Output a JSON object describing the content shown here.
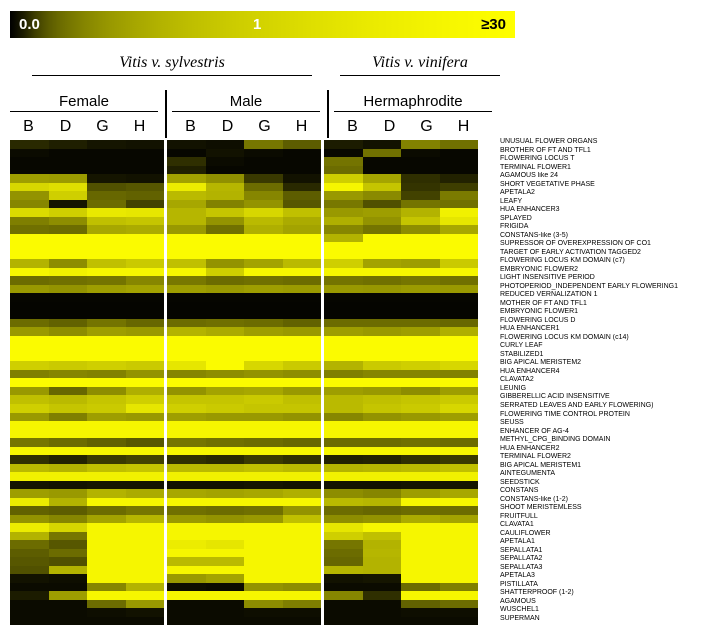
{
  "colorbar": {
    "min_label": "0.0",
    "mid_label": "1",
    "max_label": "≥30",
    "black_hex": "#000000",
    "yellow_hex": "#ffff00"
  },
  "headers": {
    "species": [
      {
        "label": "Vitis v. sylvestris"
      },
      {
        "label": "Vitis v. vinifera"
      }
    ],
    "groups": [
      {
        "label": "Female"
      },
      {
        "label": "Male"
      },
      {
        "label": "Hermaphrodite"
      }
    ],
    "columns": [
      "B",
      "D",
      "G",
      "H",
      "B",
      "D",
      "G",
      "H",
      "B",
      "D",
      "G",
      "H"
    ]
  },
  "chart_data": {
    "type": "heatmap",
    "title": "",
    "xlabel": "",
    "ylabel": "",
    "colormap": "black-to-yellow",
    "value_range": [
      0.0,
      30.0
    ],
    "colorbar_ticks": [
      0.0,
      1.0,
      30.0
    ],
    "column_groups": [
      {
        "species": "Vitis v. sylvestris",
        "sex": "Female",
        "columns": [
          "B",
          "D",
          "G",
          "H"
        ]
      },
      {
        "species": "Vitis v. sylvestris",
        "sex": "Male",
        "columns": [
          "B",
          "D",
          "G",
          "H"
        ]
      },
      {
        "species": "Vitis v. vinifera",
        "sex": "Hermaphrodite",
        "columns": [
          "B",
          "D",
          "G",
          "H"
        ]
      }
    ],
    "x": [
      "B",
      "D",
      "G",
      "H",
      "B",
      "D",
      "G",
      "H",
      "B",
      "D",
      "G",
      "H"
    ],
    "y": [
      "UNUSUAL FLOWER ORGANS",
      "BROTHER OF FT AND TFL1",
      "FLOWERING LOCUS T",
      "TERMINAL FLOWER1",
      "AGAMOUS like  24",
      "SHORT VEGETATIVE PHASE",
      "APETALA2",
      "LEAFY",
      "HUA ENHANCER3",
      "SPLAYED",
      "FRIGIDA",
      "CONSTANS-like  (3-5)",
      "SUPRESSOR OF OVEREXPRESSION OF CO1",
      "TARGET OF EARLY ACTIVATION TAGGED2",
      "FLOWERING LOCUS KM DOMAIN (c7)",
      "EMBRYONIC FLOWER2",
      "LIGHT INSENSITIVE PERIOD",
      "PHOTOPERIOD_INDEPENDENT EARLY FLOWERING1",
      "REDUCED VERNALIZATION 1",
      "MOTHER OF FT AND TFL1",
      "EMBRYONIC FLOWER1",
      "FLOWERING LOCUS D",
      "HUA ENHANCER1",
      "FLOWERING LOCUS KM DOMAIN (c14)",
      "CURLY LEAF",
      "STABILIZED1",
      "BIG APICAL MERISTEM2",
      "HUA ENHANCER4",
      "CLAVATA2",
      "LEUNIG",
      "GIBBERELLIC ACID INSENSITIVE",
      "SERRATED LEAVES AND EARLY FLOWERING)",
      "FLOWERING TIME CONTROL PROTEIN",
      "SEUSS",
      "ENHANCER OF AG-4",
      "METHYL_CPG_BINDING DOMAIN",
      "HUA ENHANCER2",
      "TERMINAL FLOWER2",
      "BIG APICAL MERISTEM1",
      "AINTEGUMENTA",
      "SEEDSTICK",
      "CONSTANS",
      "CONSTANS-like  (1-2)",
      "SHOOT MERISTEMLESS",
      "FRUITFULL",
      "CLAVATA1",
      "CAULIFLOWER",
      "APETALA1",
      "SEPALLATA1",
      "SEPALLATA2",
      "SEPALLATA3",
      "APETALA3",
      "PISTILLATA",
      "SHATTERPROOF (1-2)",
      "AGAMOUS",
      "WUSCHEL1",
      "SUPERMAN"
    ],
    "values": [
      [
        1.1,
        0.9,
        0.6,
        0.5,
        0.5,
        0.4,
        3.5,
        2.4,
        0.8,
        0.5,
        4.2,
        3.2,
        0.4,
        0.3
      ],
      [
        0.3,
        0.2,
        0.2,
        0.2,
        0.2,
        0.5,
        0.3,
        0.2,
        0.2,
        3.2,
        0.3,
        0.2
      ],
      [
        0.2,
        0.2,
        0.2,
        0.2,
        1.2,
        0.3,
        0.2,
        0.2,
        3.4,
        0.2,
        0.2,
        0.2
      ],
      [
        0.2,
        0.2,
        0.2,
        0.2,
        0.9,
        0.2,
        0.2,
        0.2,
        3.0,
        0.2,
        0.2,
        0.2
      ],
      [
        6.5,
        6.2,
        0.6,
        0.5,
        6.8,
        5.2,
        1.4,
        0.5,
        14.0,
        7.2,
        1.2,
        1.0
      ],
      [
        16.0,
        18.0,
        2.0,
        2.2,
        22.0,
        9.5,
        3.0,
        1.1,
        26.0,
        12.0,
        1.3,
        1.5
      ],
      [
        5.5,
        14.0,
        2.8,
        2.6,
        10.0,
        9.0,
        4.5,
        2.4,
        6.0,
        4.8,
        1.6,
        3.8
      ],
      [
        4.5,
        0.6,
        3.0,
        1.6,
        7.5,
        4.2,
        5.5,
        2.2,
        3.6,
        2.0,
        3.4,
        3.2
      ],
      [
        17.0,
        14.0,
        21.0,
        20.0,
        9.5,
        12.0,
        16.0,
        11.0,
        6.0,
        6.5,
        9.0,
        24.0
      ],
      [
        4.0,
        5.0,
        11.0,
        12.0,
        9.5,
        5.5,
        10.0,
        8.0,
        8.5,
        5.5,
        12.0,
        20.0
      ],
      [
        3.2,
        3.0,
        7.5,
        8.0,
        6.0,
        3.2,
        8.5,
        7.0,
        4.5,
        3.4,
        5.0,
        7.5
      ],
      [
        28.0,
        28.0,
        28.0,
        28.0,
        28.0,
        28.0,
        28.0,
        28.0,
        9.0,
        28.0,
        28.0,
        28.0
      ],
      [
        28.0,
        28.0,
        28.0,
        28.0,
        28.0,
        28.0,
        28.0,
        28.0,
        28.0,
        28.0,
        28.0,
        28.0
      ],
      [
        28.0,
        28.0,
        28.0,
        28.0,
        28.0,
        28.0,
        28.0,
        28.0,
        28.0,
        28.0,
        28.0,
        28.0
      ],
      [
        9.0,
        5.0,
        11.0,
        13.0,
        11.0,
        5.5,
        7.0,
        10.0,
        14.0,
        7.0,
        6.5,
        13.0
      ],
      [
        26.0,
        24.0,
        26.0,
        26.0,
        26.0,
        14.0,
        26.0,
        26.0,
        26.0,
        26.0,
        26.0,
        26.0
      ],
      [
        3.0,
        3.2,
        3.4,
        4.5,
        3.6,
        3.0,
        3.2,
        3.0,
        3.4,
        3.2,
        3.5,
        3.2
      ],
      [
        6.0,
        5.5,
        6.5,
        7.0,
        6.5,
        6.0,
        6.5,
        6.2,
        6.0,
        5.8,
        6.2,
        6.0
      ],
      [
        0.15,
        0.15,
        0.15,
        0.15,
        0.15,
        0.15,
        0.15,
        0.15,
        0.15,
        0.15,
        0.15,
        0.15
      ],
      [
        0.12,
        0.12,
        0.12,
        0.12,
        0.12,
        0.12,
        0.12,
        0.12,
        0.12,
        0.12,
        0.12,
        0.12
      ],
      [
        0.12,
        0.12,
        0.12,
        0.12,
        0.12,
        0.12,
        0.12,
        0.12,
        0.12,
        0.12,
        0.12,
        0.12
      ],
      [
        3.0,
        2.6,
        3.4,
        2.8,
        3.0,
        3.2,
        3.0,
        2.6,
        3.0,
        3.0,
        3.0,
        2.8
      ],
      [
        6.0,
        5.0,
        6.5,
        6.0,
        9.0,
        8.0,
        6.5,
        6.0,
        6.5,
        6.0,
        6.5,
        8.5
      ],
      [
        28.0,
        28.0,
        28.0,
        28.0,
        28.0,
        28.0,
        28.0,
        28.0,
        28.0,
        28.0,
        28.0,
        28.0
      ],
      [
        28.0,
        28.0,
        28.0,
        28.0,
        28.0,
        28.0,
        28.0,
        28.0,
        28.0,
        28.0,
        28.0,
        28.0
      ],
      [
        28.0,
        28.0,
        28.0,
        28.0,
        28.0,
        28.0,
        28.0,
        28.0,
        28.0,
        28.0,
        28.0,
        28.0
      ],
      [
        14.0,
        13.0,
        14.0,
        13.0,
        20.0,
        28.0,
        16.0,
        13.0,
        9.0,
        13.0,
        14.0,
        16.0
      ],
      [
        4.0,
        4.5,
        4.2,
        5.5,
        4.5,
        5.0,
        5.5,
        5.0,
        4.0,
        4.5,
        4.5,
        4.2
      ],
      [
        28.0,
        28.0,
        28.0,
        28.0,
        28.0,
        28.0,
        28.0,
        28.0,
        28.0,
        28.0,
        28.0,
        28.0
      ],
      [
        6.0,
        2.8,
        5.0,
        8.5,
        5.5,
        7.0,
        7.5,
        6.0,
        6.5,
        6.0,
        5.0,
        6.5
      ],
      [
        11.0,
        10.0,
        12.0,
        14.0,
        12.0,
        12.0,
        13.0,
        11.0,
        10.0,
        11.0,
        12.0,
        13.0
      ],
      [
        14.0,
        12.0,
        13.0,
        20.0,
        14.0,
        13.0,
        12.0,
        12.0,
        10.0,
        12.0,
        13.0,
        16.0
      ],
      [
        6.0,
        4.0,
        6.5,
        6.0,
        6.5,
        6.0,
        6.0,
        5.5,
        4.5,
        5.5,
        6.0,
        6.5
      ],
      [
        26.0,
        26.0,
        26.0,
        26.0,
        26.0,
        26.0,
        26.0,
        26.0,
        26.0,
        26.0,
        26.0,
        26.0
      ],
      [
        26.0,
        26.0,
        26.0,
        26.0,
        26.0,
        26.0,
        26.0,
        26.0,
        26.0,
        26.0,
        26.0,
        26.0
      ],
      [
        3.5,
        3.0,
        2.6,
        2.2,
        3.5,
        3.2,
        3.0,
        2.8,
        3.0,
        3.0,
        3.2,
        3.0
      ],
      [
        26.0,
        26.0,
        26.0,
        26.0,
        26.0,
        26.0,
        26.0,
        26.0,
        26.0,
        26.0,
        26.0,
        26.0
      ],
      [
        1.2,
        1.0,
        1.4,
        1.6,
        1.2,
        1.1,
        1.4,
        1.2,
        0.9,
        1.0,
        1.2,
        1.4
      ],
      [
        10.0,
        9.0,
        11.0,
        12.0,
        10.0,
        10.0,
        11.0,
        10.0,
        9.0,
        9.5,
        10.0,
        11.0
      ],
      [
        24.0,
        24.0,
        24.0,
        24.0,
        24.0,
        24.0,
        24.0,
        24.0,
        24.0,
        24.0,
        24.0,
        24.0
      ],
      [
        0.6,
        0.5,
        0.6,
        0.6,
        0.5,
        0.5,
        0.6,
        0.5,
        0.5,
        0.5,
        0.6,
        0.6
      ],
      [
        6.5,
        6.0,
        9.0,
        8.0,
        7.5,
        7.0,
        7.5,
        8.5,
        5.0,
        4.5,
        6.5,
        7.5
      ],
      [
        22.0,
        9.0,
        26.0,
        26.0,
        26.0,
        26.0,
        26.0,
        26.0,
        10.0,
        9.5,
        26.0,
        26.0
      ],
      [
        2.6,
        2.4,
        3.0,
        3.5,
        3.2,
        3.0,
        3.2,
        5.5,
        3.0,
        2.8,
        3.0,
        3.0
      ],
      [
        5.5,
        4.5,
        7.0,
        9.5,
        6.0,
        5.5,
        6.0,
        11.0,
        5.0,
        5.5,
        8.0,
        7.0
      ],
      [
        22.0,
        16.0,
        26.0,
        26.0,
        26.0,
        26.0,
        26.0,
        26.0,
        20.0,
        26.0,
        26.0,
        26.0
      ],
      [
        9.0,
        3.5,
        26.0,
        26.0,
        26.0,
        26.0,
        26.0,
        26.0,
        14.0,
        11.0,
        26.0,
        26.0
      ],
      [
        3.0,
        2.2,
        26.0,
        26.0,
        22.0,
        20.0,
        26.0,
        26.0,
        3.5,
        9.0,
        26.0,
        26.0
      ],
      [
        2.4,
        3.0,
        26.0,
        26.0,
        26.0,
        26.0,
        26.0,
        26.0,
        3.0,
        9.5,
        26.0,
        26.0
      ],
      [
        2.2,
        2.0,
        26.0,
        26.0,
        10.0,
        10.0,
        26.0,
        26.0,
        2.8,
        9.0,
        26.0,
        26.0
      ],
      [
        2.0,
        9.0,
        26.0,
        26.0,
        26.0,
        26.0,
        26.0,
        26.0,
        9.5,
        9.0,
        26.0,
        26.0
      ],
      [
        0.5,
        0.4,
        26.0,
        26.0,
        6.0,
        7.0,
        26.0,
        26.0,
        0.5,
        0.6,
        26.0,
        26.0
      ],
      [
        0.3,
        0.3,
        4.5,
        9.0,
        0.4,
        0.3,
        5.5,
        5.0,
        0.3,
        0.3,
        3.0,
        4.0
      ],
      [
        0.8,
        6.5,
        26.0,
        26.0,
        26.0,
        26.0,
        26.0,
        26.0,
        4.5,
        1.2,
        26.0,
        26.0
      ],
      [
        0.3,
        0.3,
        3.0,
        6.0,
        0.3,
        0.3,
        5.0,
        4.0,
        0.3,
        0.3,
        2.6,
        3.0
      ],
      [
        0.3,
        0.3,
        0.4,
        0.5,
        0.3,
        0.3,
        0.4,
        0.4,
        0.3,
        0.3,
        0.4,
        0.4
      ],
      [
        0.3,
        0.3,
        0.3,
        0.3,
        0.3,
        0.3,
        0.3,
        0.3,
        0.3,
        0.3,
        0.3,
        0.3
      ]
    ]
  }
}
